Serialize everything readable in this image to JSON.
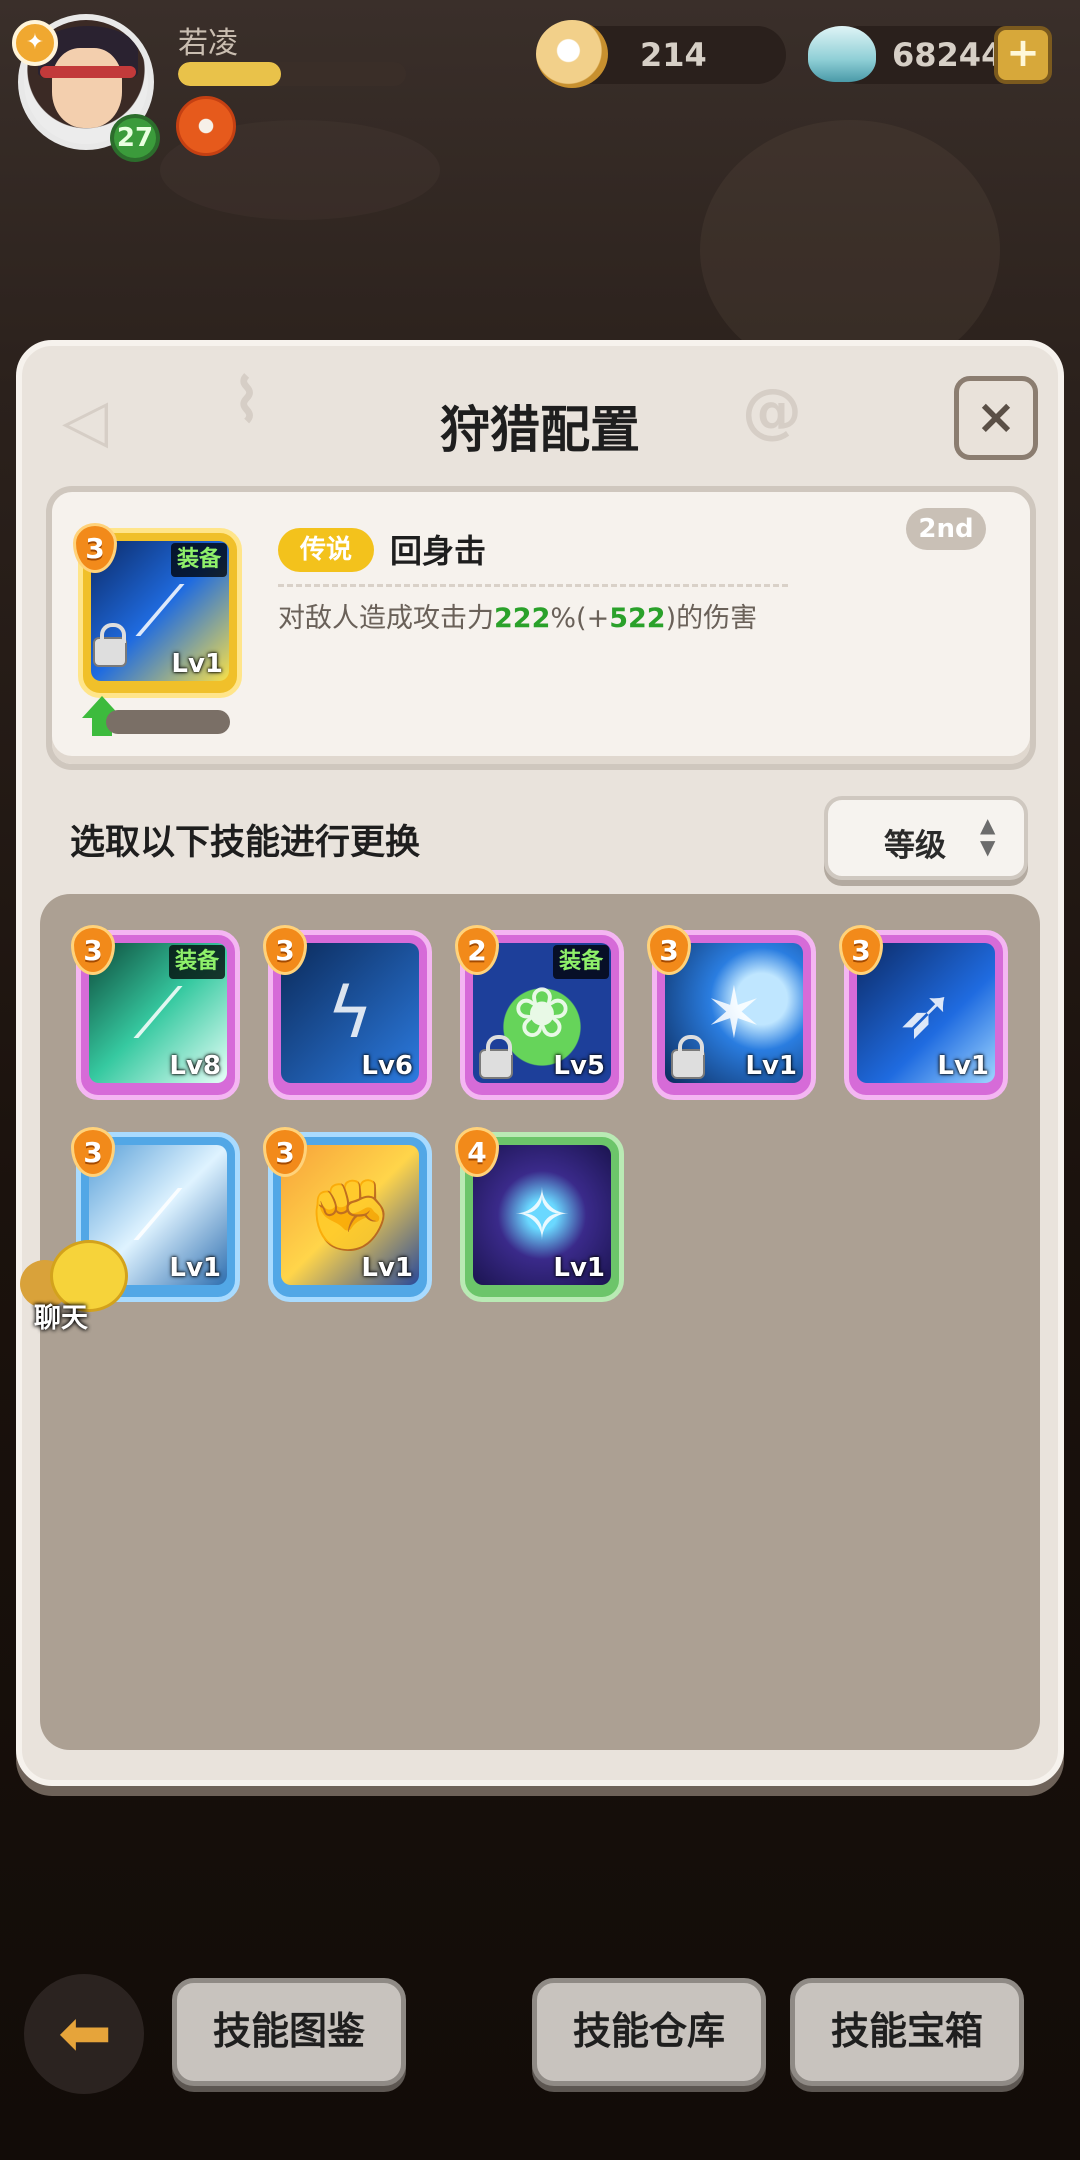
{
  "player": {
    "name": "若凌",
    "level": "27",
    "xp_fraction": 0.45
  },
  "currency": {
    "shells": "214",
    "gems": "68244",
    "add_label": "+"
  },
  "dialog": {
    "title": "狩猎配置",
    "close_label": "×"
  },
  "current_skill": {
    "cost": "3",
    "equip_tag": "装备",
    "level": "Lv1",
    "rank": "2nd",
    "quality": "传说",
    "name": "回身击",
    "desc_prefix": "对敌人造成攻击力",
    "desc_value1": "222",
    "desc_mid": "%(+",
    "desc_value2": "522",
    "desc_suffix": ")的伤害"
  },
  "replace": {
    "label": "选取以下技能进行更换",
    "sort_label": "等级"
  },
  "skills": [
    {
      "cost": "3",
      "level": "Lv8",
      "equipped": "装备",
      "frame": "purple",
      "locked": false
    },
    {
      "cost": "3",
      "level": "Lv6",
      "equipped": "",
      "frame": "purple",
      "locked": false
    },
    {
      "cost": "2",
      "level": "Lv5",
      "equipped": "装备",
      "frame": "purple",
      "locked": true
    },
    {
      "cost": "3",
      "level": "Lv1",
      "equipped": "",
      "frame": "purple",
      "locked": true
    },
    {
      "cost": "3",
      "level": "Lv1",
      "equipped": "",
      "frame": "purple",
      "locked": false
    },
    {
      "cost": "3",
      "level": "Lv1",
      "equipped": "",
      "frame": "blue",
      "locked": false
    },
    {
      "cost": "3",
      "level": "Lv1",
      "equipped": "",
      "frame": "blue",
      "locked": false
    },
    {
      "cost": "4",
      "level": "Lv1",
      "equipped": "",
      "frame": "green",
      "locked": false
    }
  ],
  "chat": {
    "label": "聊天"
  },
  "bottom": {
    "btn1": "技能图鉴",
    "btn2": "技能仓库",
    "btn3": "技能宝箱"
  }
}
